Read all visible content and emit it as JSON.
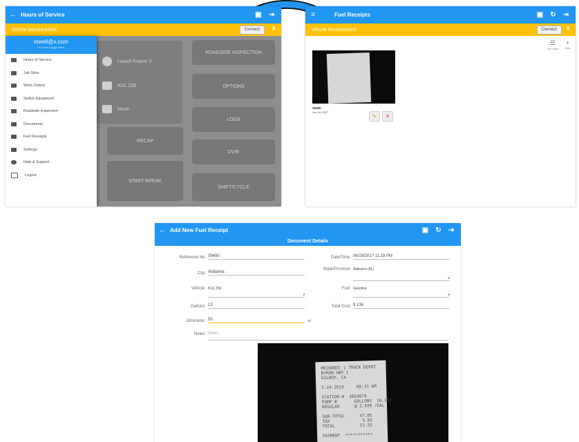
{
  "panel1": {
    "title": "Hours of Service",
    "banner": "Vehicle disconnected",
    "connect_label": "Connect",
    "close_label": "X",
    "drawer": {
      "email": "lowell@x.com",
      "sub": "for hos/e-log/ga driver",
      "items": [
        "Hours of Service",
        "Job Sites",
        "Work Orders",
        "Switch Equipment",
        "Roadside Inspection",
        "Documents",
        "Fuel Receipts",
        "Settings",
        "Help & Support",
        "Logout"
      ]
    },
    "driver_name": "Lowell Frazier II",
    "vehicle": "KUL 256",
    "trailer": "None",
    "tiles": [
      "ROADSIDE INSPECTION",
      "OPTIONS",
      "LOGS",
      "RECAP",
      "DVIR",
      "START BREAK",
      "SHIFT/CYCLE"
    ]
  },
  "panel2": {
    "title": "Fuel Receipts",
    "banner": "Vehicle disconnected",
    "connect_label": "Connect",
    "close_label": "X",
    "list_view_label": "List View",
    "add_label": "Add",
    "receipt_ref": "39490",
    "receipt_date": "Jun 19, 2017"
  },
  "panel3": {
    "title": "Add New Fuel Receipt",
    "section": "Document Details",
    "fields": {
      "reference_label": "Reference No:",
      "reference_value": "39490",
      "datetime_label": "Date/Time:",
      "datetime_value": "06/19/2017 11:29 PM",
      "city_label": "City:",
      "city_value": "Alabama",
      "state_label": "State/Province:",
      "state_value": "Alabama (AL)",
      "vehicle_label": "Vehicle:",
      "vehicle_value": "KUL 256",
      "fuel_label": "Fuel:",
      "fuel_value": "Gasoline",
      "gallons_label": "Gallons:",
      "gallons_value": "13",
      "totalcost_label": "Total Cost:",
      "totalcost_value": "$ 136",
      "odometer_label": "Odometer:",
      "odometer_value": "50",
      "odometer_unit": "mi",
      "notes_label": "Notes:",
      "notes_placeholder": "Notes"
    },
    "receipt_text": "MECHANIC 1 TRUCK DEPOT\nBYRON HWY 1\nGILROY, CA\n\n5-24-2019     08:31 AM\n\nSTATION #  3054070\nPUMP #       GALLONS  26.312\nREGULAR      @ 2.499 /GAL\n\nSUB-TOTAL      47.85\nTAX             9.03\nTOTAL          51.55\n\nPAYMENT  ***********"
  },
  "colors": {
    "appbar": "#2196f3",
    "banner": "#ffc107",
    "arrow": "#2196f3"
  }
}
